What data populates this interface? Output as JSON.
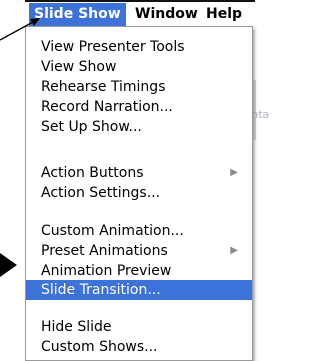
{
  "menubar": {
    "items": [
      {
        "label": "Slide Show",
        "active": true
      },
      {
        "label": "Window",
        "active": false
      },
      {
        "label": "Help",
        "active": false
      }
    ]
  },
  "menu": {
    "items": [
      {
        "label": "View Presenter Tools"
      },
      {
        "label": "View Show"
      },
      {
        "label": "Rehearse Timings"
      },
      {
        "label": "Record Narration..."
      },
      {
        "label": "Set Up Show..."
      },
      {
        "label": "Action Buttons",
        "submenu": true
      },
      {
        "label": "Action Settings..."
      },
      {
        "label": "Custom Animation..."
      },
      {
        "label": "Preset Animations",
        "submenu": true
      },
      {
        "label": "Animation Preview"
      },
      {
        "label": "Slide Transition...",
        "selected": true
      },
      {
        "label": "Hide Slide"
      },
      {
        "label": "Custom Shows..."
      }
    ]
  },
  "colors": {
    "highlight": "#3d72d8"
  },
  "background": {
    "slide_fragment_text": "esenta"
  },
  "icons": {
    "submenu": "triangle-right-icon"
  }
}
